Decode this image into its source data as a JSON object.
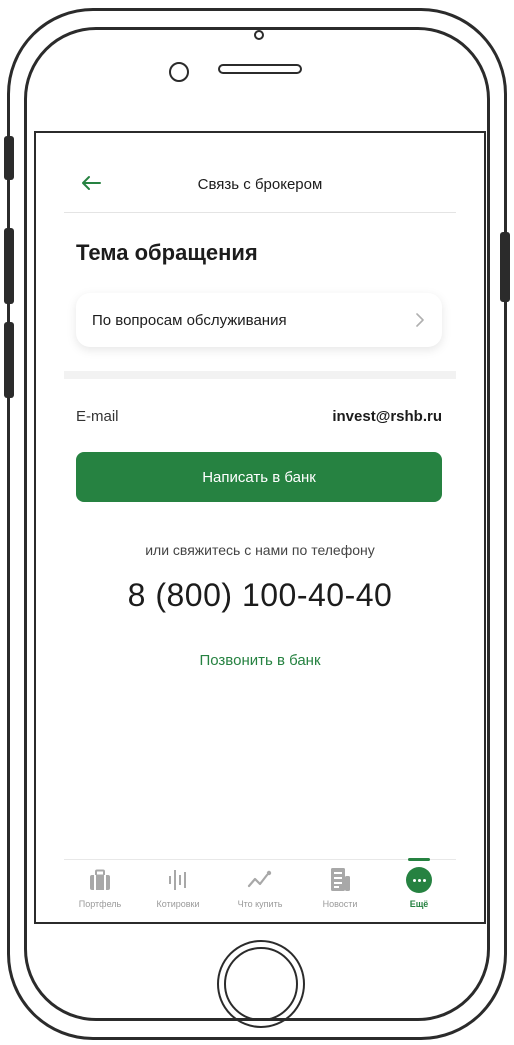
{
  "header": {
    "title": "Связь с брокером",
    "back_icon": "arrow-left-icon"
  },
  "section": {
    "title": "Тема обращения"
  },
  "topic": {
    "selected": "По вопросам обслуживания",
    "chevron_icon": "chevron-right-icon"
  },
  "contact": {
    "email_label": "E-mail",
    "email_value": "invest@rshb.ru",
    "write_button": "Написать в банк",
    "or_text": "или свяжитесь с нами по телефону",
    "phone": "8 (800) 100-40-40",
    "call_link": "Позвонить в банк"
  },
  "tabs": [
    {
      "label": "Портфель",
      "icon": "briefcase-icon"
    },
    {
      "label": "Котировки",
      "icon": "quotes-bars-icon"
    },
    {
      "label": "Что купить",
      "icon": "trend-line-icon"
    },
    {
      "label": "Новости",
      "icon": "newspaper-icon"
    },
    {
      "label": "Ещё",
      "icon": "more-dots-icon",
      "active": true
    }
  ],
  "colors": {
    "accent": "#268241",
    "text": "#1c1c1c",
    "muted": "#9a9a9a",
    "frame": "#2b2b2b"
  }
}
